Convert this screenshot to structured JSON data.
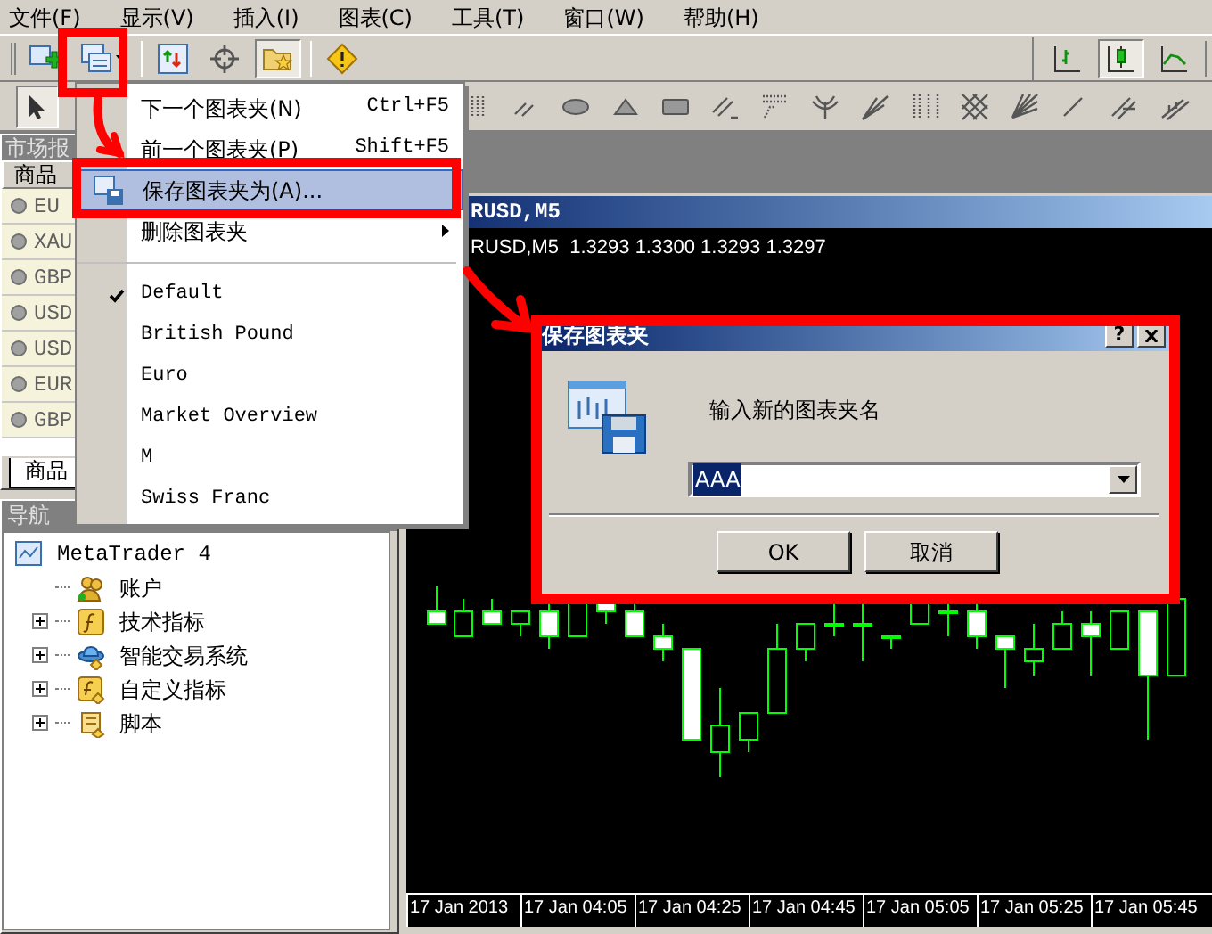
{
  "menu_bar": [
    "文件(F)",
    "显示(V)",
    "插入(I)",
    "图表(C)",
    "工具(T)",
    "窗口(W)",
    "帮助(H)"
  ],
  "toolbar": {
    "buttons": [
      {
        "kind": "new-chart",
        "pressed": false
      },
      {
        "kind": "profiles",
        "pressed": false
      },
      {
        "kind": "chart-window",
        "pressed": false
      },
      {
        "kind": "crosshair",
        "pressed": false
      },
      {
        "kind": "favorites",
        "pressed": true
      },
      {
        "kind": "alert",
        "pressed": false
      }
    ],
    "chart_types": [
      {
        "kind": "bar",
        "selected": false
      },
      {
        "kind": "candle",
        "selected": true
      },
      {
        "kind": "line",
        "selected": false
      }
    ]
  },
  "drawing_toolbar": {
    "cursor_pressed": true
  },
  "market_watch": {
    "title": "市场报",
    "column": "商品",
    "rows": [
      "EU",
      "XAU",
      "GBP",
      "USD",
      "USD",
      "EUR",
      "GBP"
    ],
    "tab": "商品"
  },
  "navigator": {
    "title": "导航",
    "tree": [
      {
        "label": "MetaTrader 4",
        "kind": "terminal",
        "children": [
          {
            "label": "账户",
            "kind": "accounts"
          },
          {
            "label": "技术指标",
            "kind": "indicator",
            "expanded": false
          },
          {
            "label": "智能交易系统",
            "kind": "expert",
            "expanded": false
          },
          {
            "label": "自定义指标",
            "kind": "custom",
            "expanded": false
          },
          {
            "label": "脚本",
            "kind": "script",
            "expanded": false
          }
        ]
      }
    ]
  },
  "chart": {
    "title": "RUSD,M5",
    "info": "RUSD,M5  1.3293 1.3300 1.3293 1.3297",
    "x_labels": [
      "17 Jan 2013",
      "17 Jan 04:05",
      "17 Jan 04:25",
      "17 Jan 04:45",
      "17 Jan 05:05",
      "17 Jan 05:25",
      "17 Jan 05:45"
    ]
  },
  "profiles_menu": {
    "items": [
      {
        "kind": "command",
        "label": "下一个图表夹(N)",
        "shortcut": "Ctrl+F5",
        "selected": false
      },
      {
        "kind": "command",
        "label": "前一个图表夹(P)",
        "shortcut": "Shift+F5",
        "selected": false
      },
      {
        "kind": "command",
        "label": "保存图表夹为(A)...",
        "selected": true
      },
      {
        "kind": "submenu",
        "label": "删除图表夹",
        "selected": false
      },
      {
        "kind": "separator"
      },
      {
        "kind": "profile",
        "label": "Default",
        "checked": true
      },
      {
        "kind": "profile",
        "label": "British Pound",
        "checked": false
      },
      {
        "kind": "profile",
        "label": "Euro",
        "checked": false
      },
      {
        "kind": "profile",
        "label": "Market Overview",
        "checked": false
      },
      {
        "kind": "profile",
        "label": "M",
        "checked": false
      },
      {
        "kind": "profile",
        "label": "Swiss Franc",
        "checked": false
      }
    ]
  },
  "dialog": {
    "title": "保存图表夹",
    "help": "?",
    "prompt": "输入新的图表夹名",
    "value": "AAA",
    "value_selected": true,
    "buttons": [
      "OK",
      "取消"
    ]
  }
}
